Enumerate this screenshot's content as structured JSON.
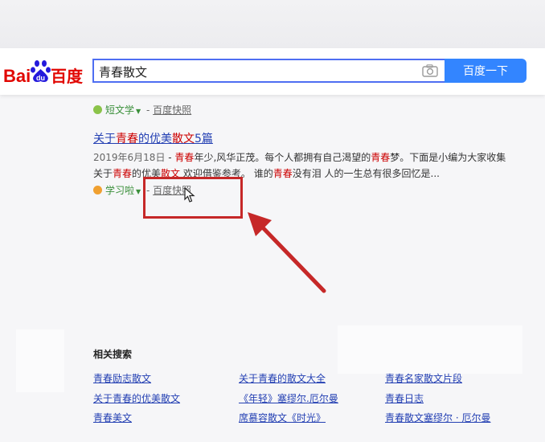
{
  "header": {
    "search_value": "青春散文",
    "search_button_label": "百度一下"
  },
  "results": {
    "cut_text": "… … … … … … … … … … … … … … … … … … …",
    "first_source": {
      "name": "短文学",
      "cache_label": "百度快照"
    },
    "second": {
      "title_pre": "关于",
      "title_em": "青春",
      "title_mid": "的优美",
      "title_em2": "散文",
      "title_post": "5篇",
      "date": "2019年6月18日",
      "snippet_sep": " - ",
      "s1": "青春",
      "s2": "年少,风华正茂。每个人都拥有自己渴望的",
      "s3": "青春",
      "s4": "梦。下面是小编为大家收集关于",
      "s5": "青春",
      "s6": "的优美",
      "s7": "散文",
      "s8": " 欢迎借鉴参考。 谁的",
      "s9": "青春",
      "s10": "没有泪 人的一生总有很多回忆是...",
      "source_name": "学习啦",
      "cache_label": "百度快照"
    }
  },
  "related": {
    "heading": "相关搜索",
    "links": [
      [
        "青春励志散文",
        "关于青春的散文大全",
        "青春名家散文片段"
      ],
      [
        "关于青春的优美散文",
        "《年轻》塞缪尔.厄尔曼",
        "青春日志"
      ],
      [
        "青春美文",
        "席慕容散文《时光》",
        "青春散文塞缪尔 · 厄尔曼"
      ]
    ]
  },
  "colors": {
    "accent": "#3385ff",
    "highlight": "#c62828",
    "link": "#2440b3",
    "em": "#cc0000"
  }
}
